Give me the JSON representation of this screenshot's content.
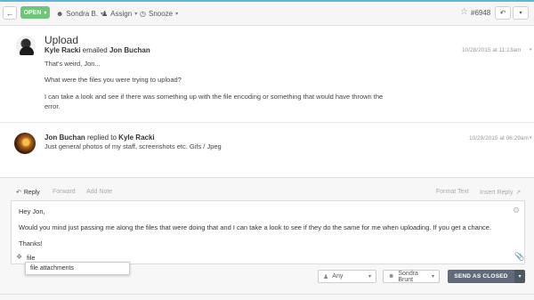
{
  "toolbar": {
    "open_label": "OPEN",
    "assignee_label": "Sondra B.",
    "assign_label": "Assign",
    "snooze_label": "Snooze",
    "ticket_number": "#6948"
  },
  "conversation": {
    "subject": "Upload",
    "messages": [
      {
        "author": "Kyle Racki",
        "action": "emailed",
        "recipient": "Jon Buchan",
        "date": "10/28/2015 at 11:13am",
        "lines": [
          "That's weird, Jon...",
          "What were the files you were trying to upload?",
          "I can take a look and see if there was something up with the file encoding or something that would have thrown the",
          "error."
        ]
      },
      {
        "author": "Jon Buchan",
        "action": "replied to",
        "recipient": "Kyle Racki",
        "date": "10/29/2015 at 06:29am",
        "lines": [
          "Just general photos of my staff, screenshots etc. Gifs / Jpeg"
        ]
      }
    ]
  },
  "reply": {
    "tabs": {
      "reply": "Reply",
      "forward": "Forward",
      "add_note": "Add Note"
    },
    "format_text": "Format Text",
    "insert_reply": "Insert Reply",
    "editor_lines": [
      "Hey Jon,",
      "Would you mind just passing me along the files that were doing that and I can take a look to see if they do the same for me when uploading. If you get a chance.",
      "Thanks!"
    ],
    "tag_input_value": "file",
    "autocomplete_item": "file attachments",
    "status_select": "Any",
    "assignee_select": "Sondra Brunt",
    "send_label": "SEND AS CLOSED"
  },
  "colors": {
    "open_green": "#70c57a",
    "send_button": "#5f6b7a",
    "top_accent": "#5bb8d8"
  }
}
